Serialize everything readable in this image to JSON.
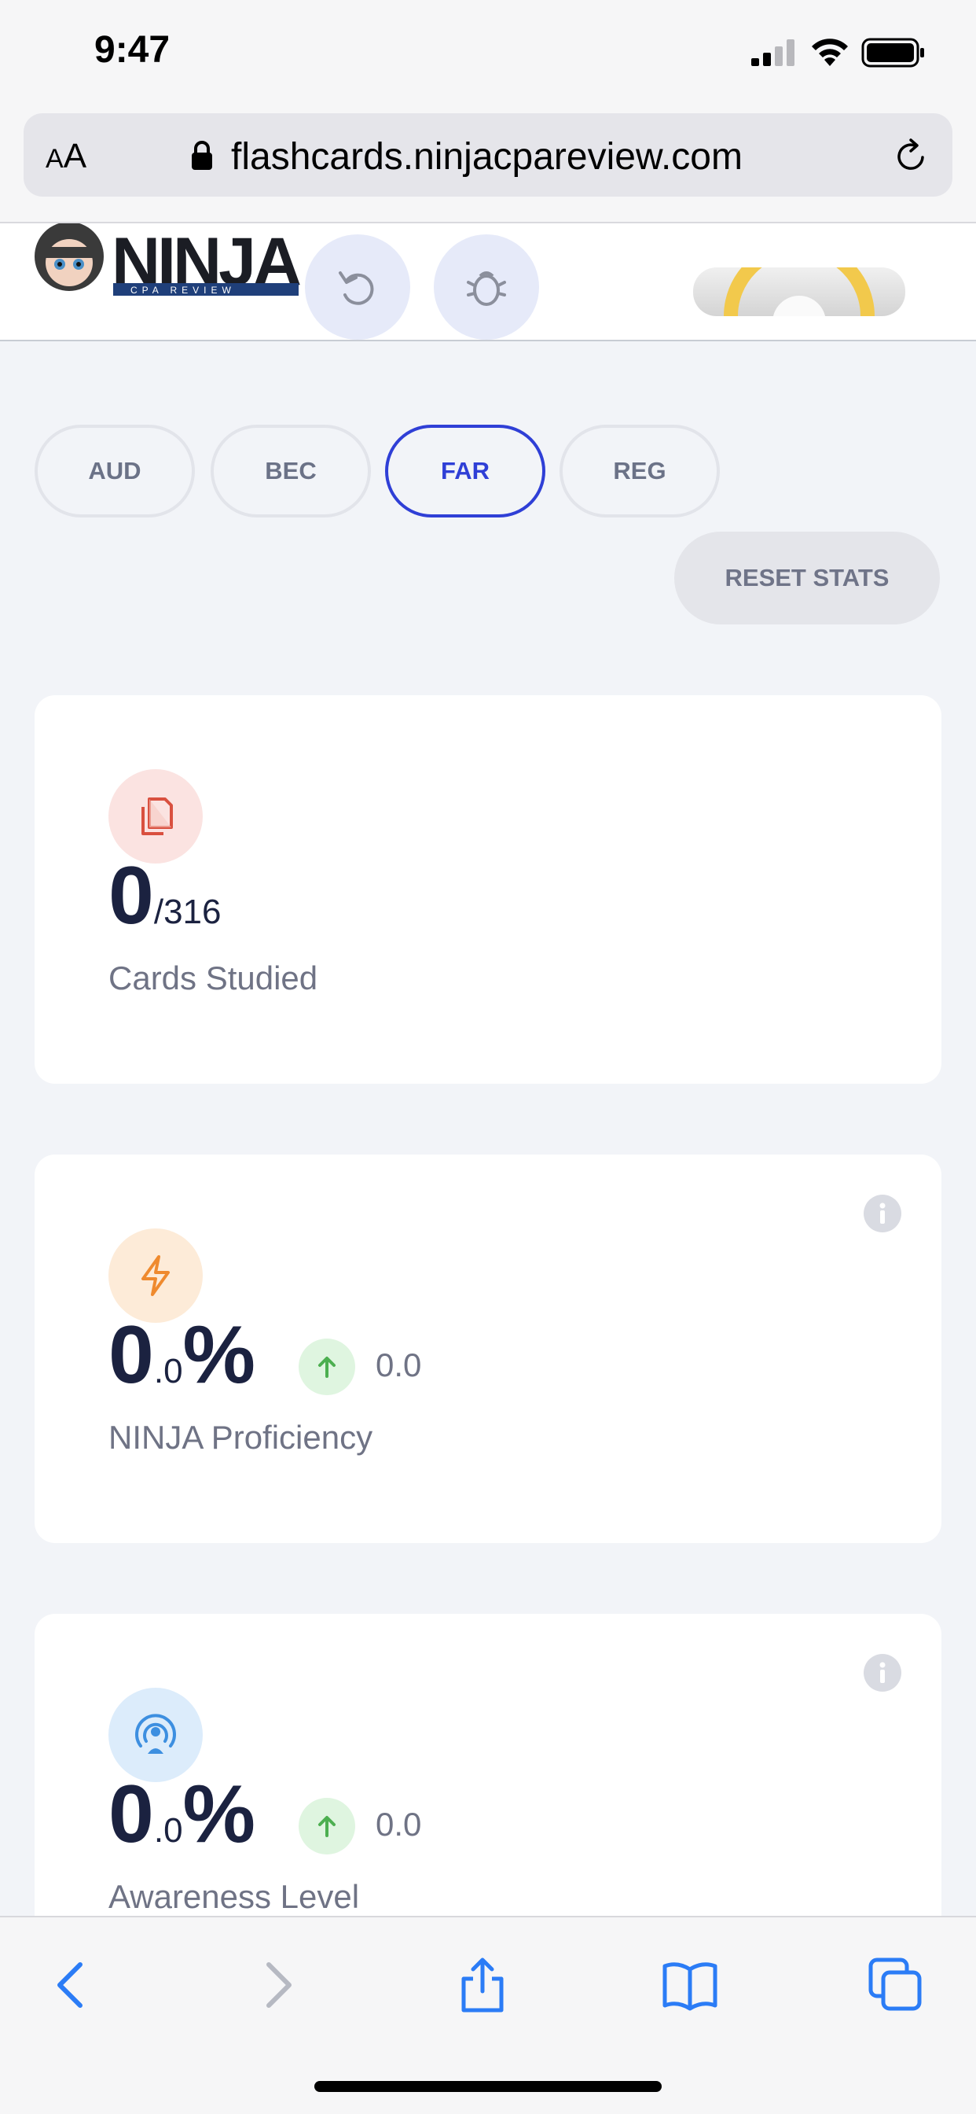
{
  "status_bar": {
    "time": "9:47"
  },
  "browser": {
    "text_size_label": "AA",
    "url": "flashcards.ninjacpareview.com"
  },
  "header": {
    "logo_text": "NINJA",
    "logo_subtext": "CPA REVIEW"
  },
  "tabs": [
    {
      "label": "AUD",
      "active": false
    },
    {
      "label": "BEC",
      "active": false
    },
    {
      "label": "FAR",
      "active": true
    },
    {
      "label": "REG",
      "active": false
    }
  ],
  "reset_label": "RESET STATS",
  "cards": {
    "studied": {
      "value": "0",
      "total": "/316",
      "label": "Cards Studied",
      "icon": "cards-copy-icon",
      "icon_color": "#d9503f",
      "icon_bg": "#fbe3e1"
    },
    "proficiency": {
      "value_int": "0",
      "value_dec": ".0",
      "unit": "%",
      "delta": "0.0",
      "label": "NINJA Proficiency",
      "icon": "lightning-icon",
      "icon_color": "#ef8a2e",
      "icon_bg": "#fdebd8"
    },
    "awareness": {
      "value_int": "0",
      "value_dec": ".0",
      "unit": "%",
      "delta": "0.0",
      "label": "Awareness Level",
      "icon": "broadcast-user-icon",
      "icon_color": "#3d8fe0",
      "icon_bg": "#dcecfb"
    }
  },
  "colors": {
    "accent": "#2f3fd6",
    "delta_up": "#4caf50"
  }
}
